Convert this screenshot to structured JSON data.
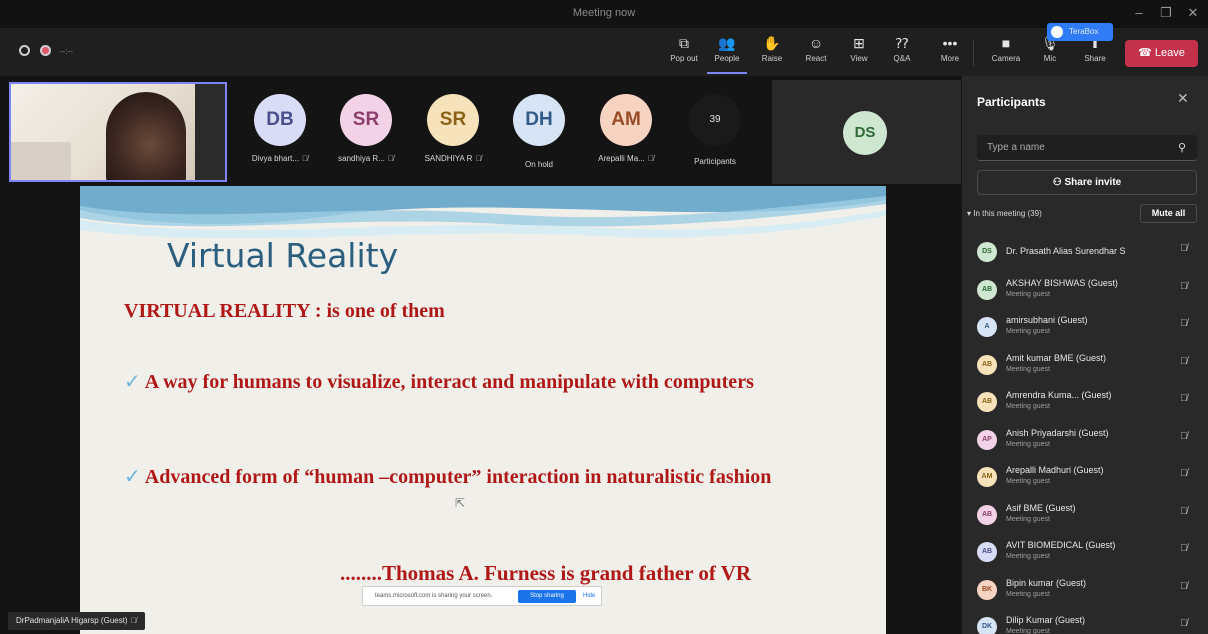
{
  "window": {
    "title": "Meeting now",
    "terabox_tip": "TeraBox"
  },
  "toolbar": {
    "timer": "--:--",
    "items": [
      {
        "label": "Pop out",
        "glyph": "⧉"
      },
      {
        "label": "People",
        "glyph": "👥"
      },
      {
        "label": "Raise",
        "glyph": "✋"
      },
      {
        "label": "React",
        "glyph": "☺"
      },
      {
        "label": "View",
        "glyph": "⊞"
      },
      {
        "label": "Q&A",
        "glyph": "⁇"
      },
      {
        "label": "More",
        "glyph": "•••"
      },
      {
        "label": "Camera",
        "glyph": "■"
      },
      {
        "label": "Mic",
        "glyph": "🎙"
      },
      {
        "label": "Share",
        "glyph": "⬆"
      }
    ],
    "leave_label": "Leave",
    "leave_color": "#c4314b"
  },
  "stage": {
    "avatars": [
      {
        "initials": "DB",
        "label": "Divya bhart...",
        "muted": true,
        "bg": "#d8dcf7",
        "fg": "#4a4f8c"
      },
      {
        "initials": "SR",
        "label": "sandhiya R...",
        "muted": true,
        "bg": "#f2d2e6",
        "fg": "#8c3f6c"
      },
      {
        "initials": "SR",
        "label": "SANDHIYA R",
        "muted": true,
        "bg": "#f6e3bc",
        "fg": "#8a6218"
      },
      {
        "initials": "DH",
        "label": "On hold",
        "muted": false,
        "bg": "#d6e4f5",
        "fg": "#335b87"
      },
      {
        "initials": "AM",
        "label": "Arepalli Ma...",
        "muted": true,
        "bg": "#f7d3c2",
        "fg": "#9a4a26"
      }
    ],
    "participants_count": "39",
    "participants_label": "Participants",
    "ds_initials": "DS"
  },
  "slide": {
    "title": "Virtual Reality",
    "heading": "VIRTUAL REALITY : is one of them",
    "bullet1": "A way for humans to visualize, interact and manipulate with computers",
    "bullet2": "Advanced form of “human –computer” interaction in naturalistic fashion",
    "quote": "........Thomas A. Furness is grand father of VR"
  },
  "share_bar": {
    "text": "teams.microsoft.com is sharing your screen.",
    "stop_label": "Stop sharing",
    "hide_label": "Hide"
  },
  "presenter_tag": "DrPadmanjaliA Higarsp (Guest)",
  "panel": {
    "title": "Participants",
    "search_placeholder": "Type a name",
    "share_invite": "Share invite",
    "in_meeting": "In this meeting (39)",
    "mute_all": "Mute all",
    "participants": [
      {
        "initials": "DS",
        "name": "Dr. Prasath Alias Surendhar S",
        "sub": "",
        "bg": "#cfe6d1",
        "fg": "#2d6a35"
      },
      {
        "initials": "AB",
        "name": "AKSHAY BISHWAS (Guest)",
        "sub": "Meeting guest",
        "bg": "#cfe6d1",
        "fg": "#2d6a35"
      },
      {
        "initials": "A",
        "name": "amirsubhani (Guest)",
        "sub": "Meeting guest",
        "bg": "#d6e4f5",
        "fg": "#335b87"
      },
      {
        "initials": "AB",
        "name": "Amit kumar BME (Guest)",
        "sub": "Meeting guest",
        "bg": "#f6e3bc",
        "fg": "#8a6218"
      },
      {
        "initials": "AB",
        "name": "Amrendra Kuma... (Guest)",
        "sub": "Meeting guest",
        "bg": "#f6e3bc",
        "fg": "#8a6218"
      },
      {
        "initials": "AP",
        "name": "Anish Priyadarshi (Guest)",
        "sub": "Meeting guest",
        "bg": "#f2d2e6",
        "fg": "#8c3f6c"
      },
      {
        "initials": "AM",
        "name": "Arepalli Madhuri (Guest)",
        "sub": "Meeting guest",
        "bg": "#f6e3bc",
        "fg": "#8a6218"
      },
      {
        "initials": "AB",
        "name": "Asif BME (Guest)",
        "sub": "Meeting guest",
        "bg": "#f2d2e6",
        "fg": "#8c3f6c"
      },
      {
        "initials": "AB",
        "name": "AVIT BIOMEDICAL (Guest)",
        "sub": "Meeting guest",
        "bg": "#d8dcf7",
        "fg": "#4a4f8c"
      },
      {
        "initials": "BK",
        "name": "Bipin kumar (Guest)",
        "sub": "Meeting guest",
        "bg": "#f7d3c2",
        "fg": "#9a4a26"
      },
      {
        "initials": "DK",
        "name": "Dilip Kumar (Guest)",
        "sub": "Meeting guest",
        "bg": "#d6e4f5",
        "fg": "#335b87"
      }
    ]
  }
}
